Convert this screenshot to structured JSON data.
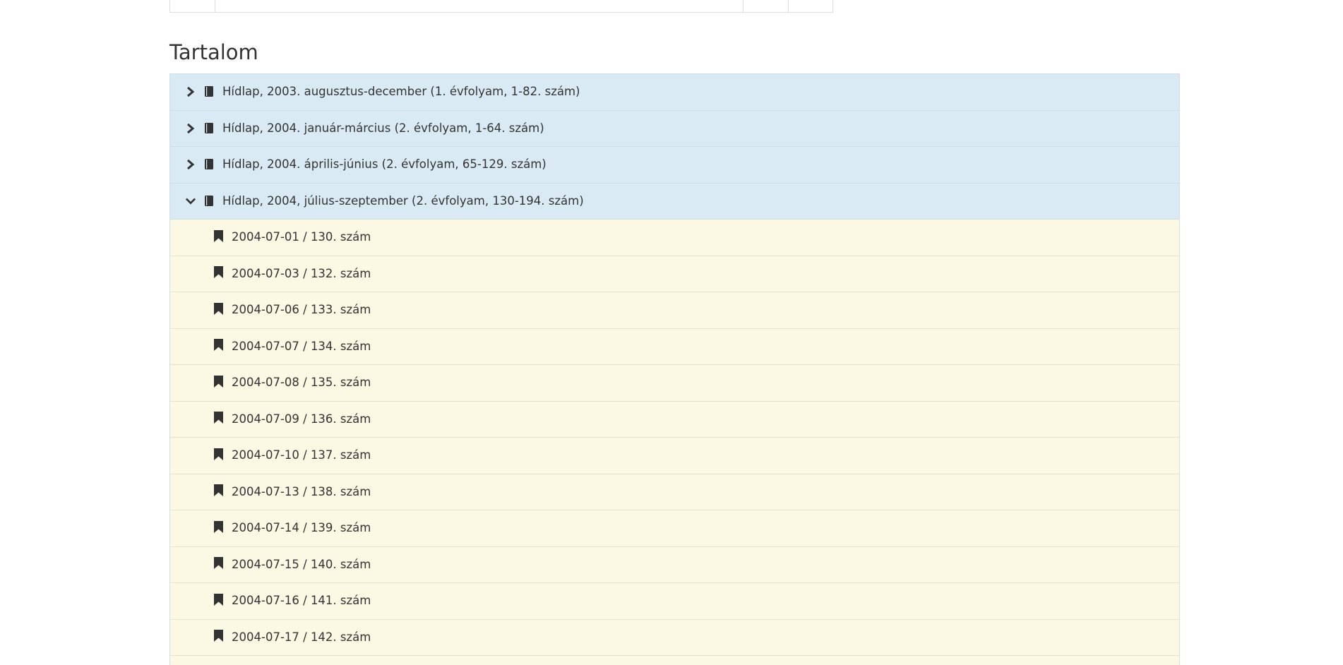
{
  "section": {
    "title": "Tartalom"
  },
  "volumes": [
    {
      "label": "Hídlap, 2003. augusztus-december (1. évfolyam, 1-82. szám)",
      "expanded": false
    },
    {
      "label": "Hídlap, 2004. január-március (2. évfolyam, 1-64. szám)",
      "expanded": false
    },
    {
      "label": "Hídlap, 2004. április-június (2. évfolyam, 65-129. szám)",
      "expanded": false
    },
    {
      "label": "Hídlap, 2004, július-szeptember (2. évfolyam, 130-194. szám)",
      "expanded": true
    }
  ],
  "issues": [
    {
      "label": "2004-07-01 / 130. szám"
    },
    {
      "label": "2004-07-03 / 132. szám"
    },
    {
      "label": "2004-07-06 / 133. szám"
    },
    {
      "label": "2004-07-07 / 134. szám"
    },
    {
      "label": "2004-07-08 / 135. szám"
    },
    {
      "label": "2004-07-09 / 136. szám"
    },
    {
      "label": "2004-07-10 / 137. szám"
    },
    {
      "label": "2004-07-13 / 138. szám"
    },
    {
      "label": "2004-07-14 / 139. szám"
    },
    {
      "label": "2004-07-15 / 140. szám"
    },
    {
      "label": "2004-07-16 / 141. szám"
    },
    {
      "label": "2004-07-17 / 142. szám"
    }
  ],
  "icons": {
    "collapsed": "chevron-right-icon",
    "expanded": "chevron-down-icon",
    "volume": "book-icon",
    "issue": "bookmark-icon"
  },
  "colors": {
    "volume_bg": "#d9eaf5",
    "issue_bg": "#fbf8e4",
    "text": "#333333"
  }
}
